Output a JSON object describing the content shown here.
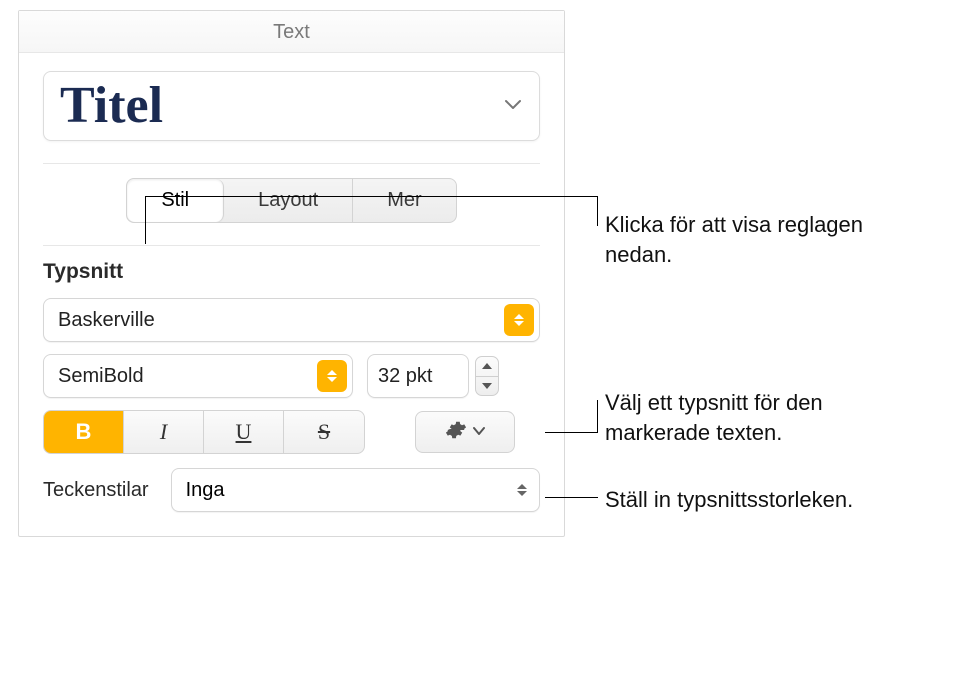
{
  "header": {
    "title": "Text"
  },
  "style_preview": {
    "name": "Titel"
  },
  "tabs": {
    "stil": "Stil",
    "layout": "Layout",
    "mer": "Mer"
  },
  "font_section": {
    "label": "Typsnitt",
    "family": "Baskerville",
    "weight": "SemiBold",
    "size_display": "32 pkt"
  },
  "bius": {
    "bold": "B",
    "italic": "I",
    "underline": "U",
    "strike": "S"
  },
  "character_styles": {
    "label": "Teckenstilar",
    "value": "Inga"
  },
  "callouts": {
    "tabs": "Klicka för att visa reglagen nedan.",
    "font": "Välj ett typsnitt för den markerade texten.",
    "size": "Ställ in typsnittsstorleken."
  }
}
